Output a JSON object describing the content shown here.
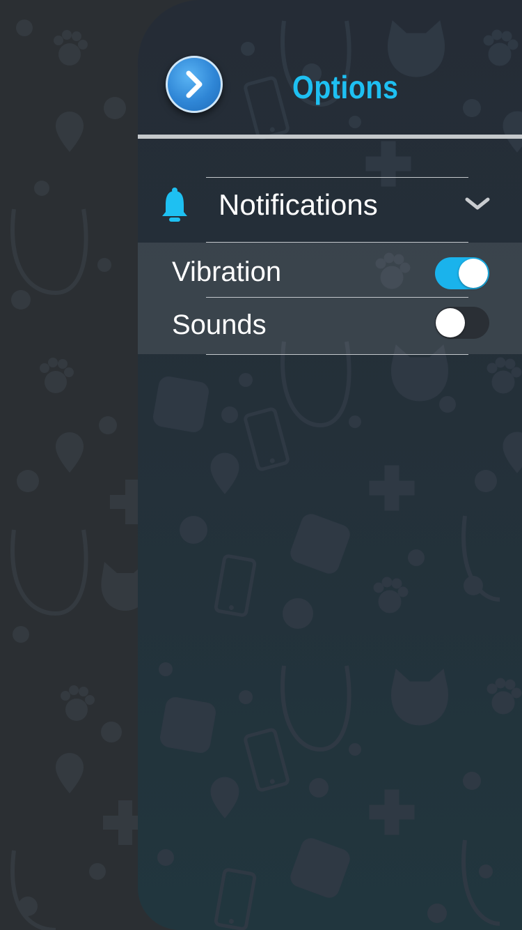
{
  "header": {
    "title": "Options",
    "back_icon": "chevron-right-icon",
    "accent_color": "#1ec0f2"
  },
  "notifications": {
    "label": "Notifications",
    "icon": "bell-icon",
    "expand_icon": "chevron-down-icon",
    "expanded": true,
    "options": [
      {
        "label": "Vibration",
        "enabled": true
      },
      {
        "label": "Sounds",
        "enabled": false
      }
    ]
  },
  "colors": {
    "toggle_on": "#1ab3ec",
    "toggle_off": "#2a2f35",
    "bell": "#1ec0f2"
  }
}
